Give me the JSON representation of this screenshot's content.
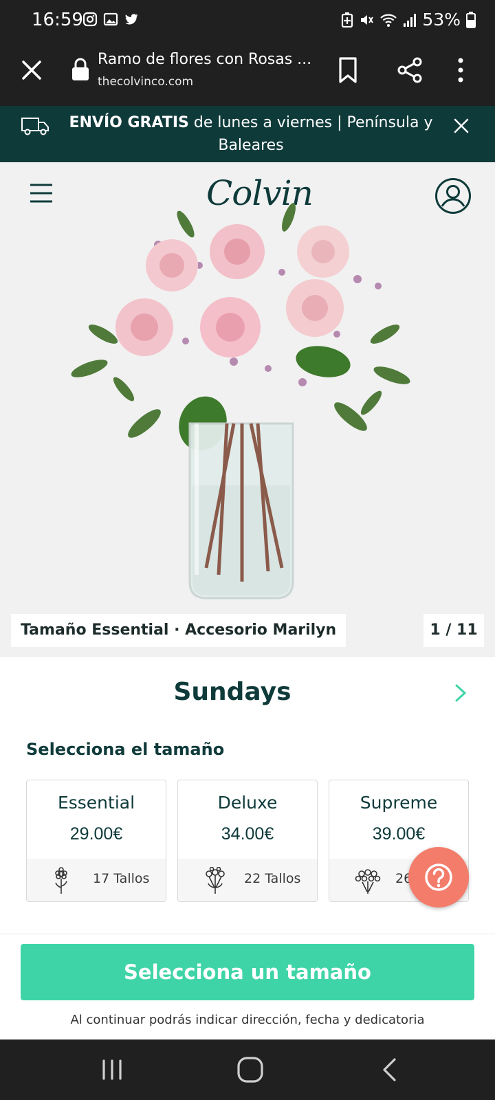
{
  "status_bar": {
    "time": "16:59",
    "battery": "53%"
  },
  "browser": {
    "page_title": "Ramo de flores con Rosas ...",
    "domain": "thecolvinco.com"
  },
  "banner": {
    "bold": "ENVÍO GRATIS",
    "text": " de lunes a viernes | Península y Baleares"
  },
  "header": {
    "logo": "Colvin"
  },
  "gallery": {
    "caption": "Tamaño Essential · Accesorio Marilyn",
    "counter": "1 / 11"
  },
  "product": {
    "name": "Sundays",
    "size_heading": "Selecciona el tamaño",
    "sizes": [
      {
        "name": "Essential",
        "price": "29.00€",
        "stems": "17 Tallos"
      },
      {
        "name": "Deluxe",
        "price": "34.00€",
        "stems": "22 Tallos"
      },
      {
        "name": "Supreme",
        "price": "39.00€",
        "stems": "26"
      }
    ]
  },
  "cta": {
    "label": "Selecciona un tamaño",
    "note": "Al continuar podrás indicar dirección, fecha y dedicatoria"
  },
  "colors": {
    "brand_dark": "#0f3a3a",
    "cta_green": "#3fd4a7",
    "help_coral": "#f47c6b"
  }
}
